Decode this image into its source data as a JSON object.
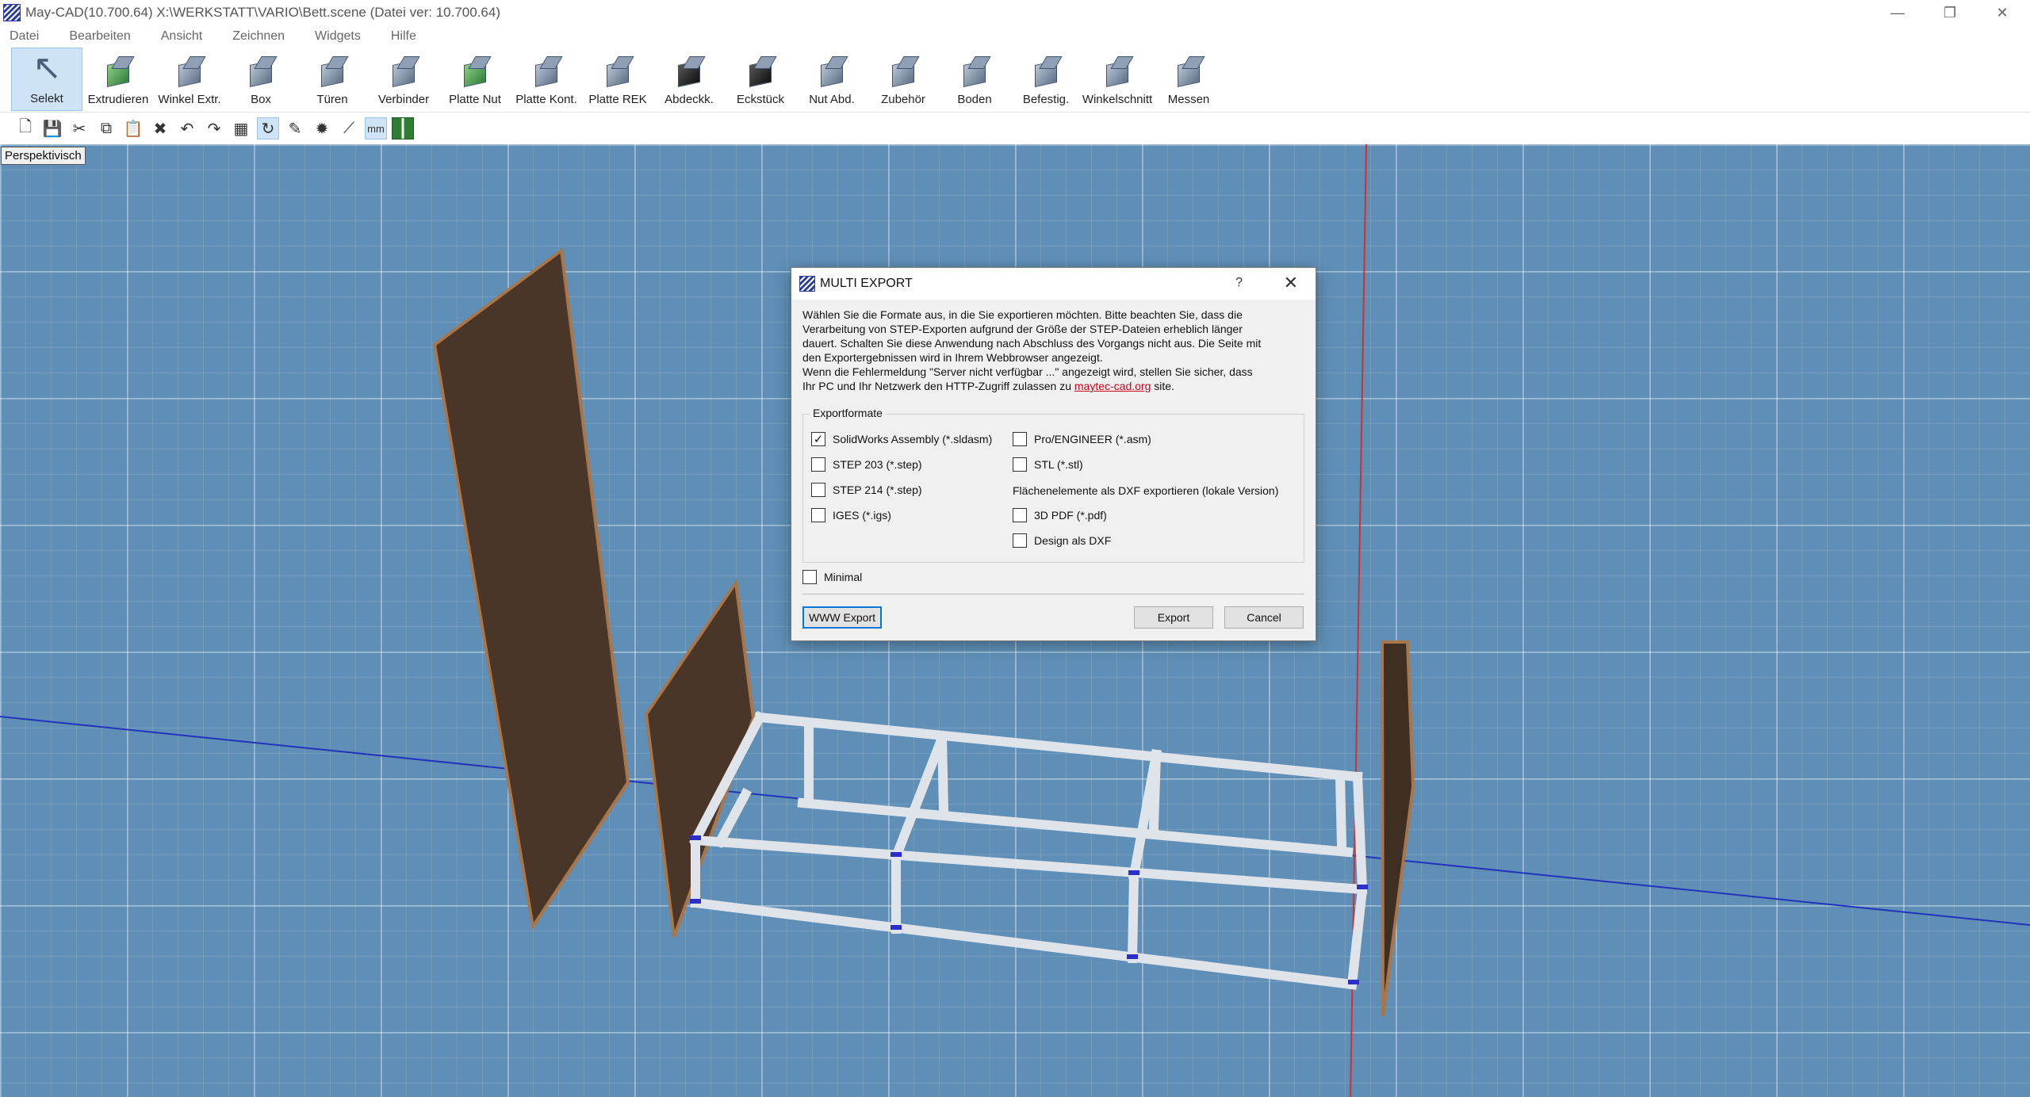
{
  "window": {
    "title": "May-CAD(10.700.64) X:\\WERKSTATT\\VARIO\\Bett.scene (Datei ver: 10.700.64)",
    "controls": {
      "minimize": "—",
      "restore": "❐",
      "close": "✕"
    }
  },
  "menu": [
    "Datei",
    "Bearbeiten",
    "Ansicht",
    "Zeichnen",
    "Widgets",
    "Hilfe"
  ],
  "ribbon": [
    {
      "label": "Selekt",
      "icon": "cursor-icon"
    },
    {
      "label": "Extrudieren",
      "icon": "extrude-icon"
    },
    {
      "label": "Winkel Extr.",
      "icon": "angle-extrude-icon"
    },
    {
      "label": "Box",
      "icon": "box-icon"
    },
    {
      "label": "Türen",
      "icon": "door-icon"
    },
    {
      "label": "Verbinder",
      "icon": "connector-icon"
    },
    {
      "label": "Platte Nut",
      "icon": "plate-groove-icon"
    },
    {
      "label": "Platte Kont.",
      "icon": "plate-contour-icon"
    },
    {
      "label": "Platte REK",
      "icon": "plate-rek-icon"
    },
    {
      "label": "Abdeckk.",
      "icon": "cover-cap-icon"
    },
    {
      "label": "Eckstück",
      "icon": "corner-piece-icon"
    },
    {
      "label": "Nut Abd.",
      "icon": "groove-cover-icon"
    },
    {
      "label": "Zubehör",
      "icon": "accessories-icon"
    },
    {
      "label": "Boden",
      "icon": "floor-icon"
    },
    {
      "label": "Befestig.",
      "icon": "fastener-icon"
    },
    {
      "label": "Winkelschnitt",
      "icon": "miter-cut-icon"
    },
    {
      "label": "Messen",
      "icon": "measure-icon"
    }
  ],
  "quickbar": {
    "icons": [
      "new-icon",
      "save-icon",
      "cut-icon",
      "copy-icon",
      "paste-icon",
      "delete-icon",
      "undo-icon",
      "redo-icon",
      "grid-select-icon",
      "rotate-icon",
      "edit-icon",
      "settings-icon",
      "measure-line-icon"
    ],
    "units_label": "mm"
  },
  "viewport": {
    "label": "Perspektivisch"
  },
  "dialog": {
    "title": "MULTI EXPORT",
    "help": "?",
    "close": "✕",
    "desc_lines": [
      "Wählen Sie die Formate aus, in die Sie exportieren möchten. Bitte beachten Sie, dass die",
      "Verarbeitung von STEP-Exporten aufgrund der Größe der STEP-Dateien erheblich länger",
      "dauert. Schalten Sie diese Anwendung nach Abschluss des Vorgangs nicht aus. Die Seite mit",
      "den Exportergebnissen wird in Ihrem Webbrowser angezeigt.",
      "Wenn die Fehlermeldung \"Server nicht verfügbar ...\" angezeigt wird, stellen Sie sicher, dass"
    ],
    "desc_last_prefix": "Ihr PC und Ihr Netzwerk den HTTP-Zugriff zulassen zu ",
    "desc_link": "maytec-cad.org",
    "desc_last_suffix": " site.",
    "group_title": "Exportformate",
    "left_options": [
      {
        "label": "SolidWorks Assembly (*.sldasm)",
        "checked": true
      },
      {
        "label": "STEP 203 (*.step)",
        "checked": false
      },
      {
        "label": "STEP 214 (*.step)",
        "checked": false
      },
      {
        "label": "IGES (*.igs)",
        "checked": false
      }
    ],
    "right_options": [
      {
        "label": "Pro/ENGINEER (*.asm)",
        "checked": false
      },
      {
        "label": "STL (*.stl)",
        "checked": false
      }
    ],
    "dxf_note": "Flächenelemente als DXF exportieren (lokale Version)",
    "right_options_2": [
      {
        "label": "3D PDF (*.pdf)",
        "checked": false
      },
      {
        "label": "Design als DXF",
        "checked": false
      }
    ],
    "minimal_label": "Minimal",
    "minimal_checked": false,
    "buttons": {
      "www": "WWW Export",
      "export": "Export",
      "cancel": "Cancel"
    }
  }
}
